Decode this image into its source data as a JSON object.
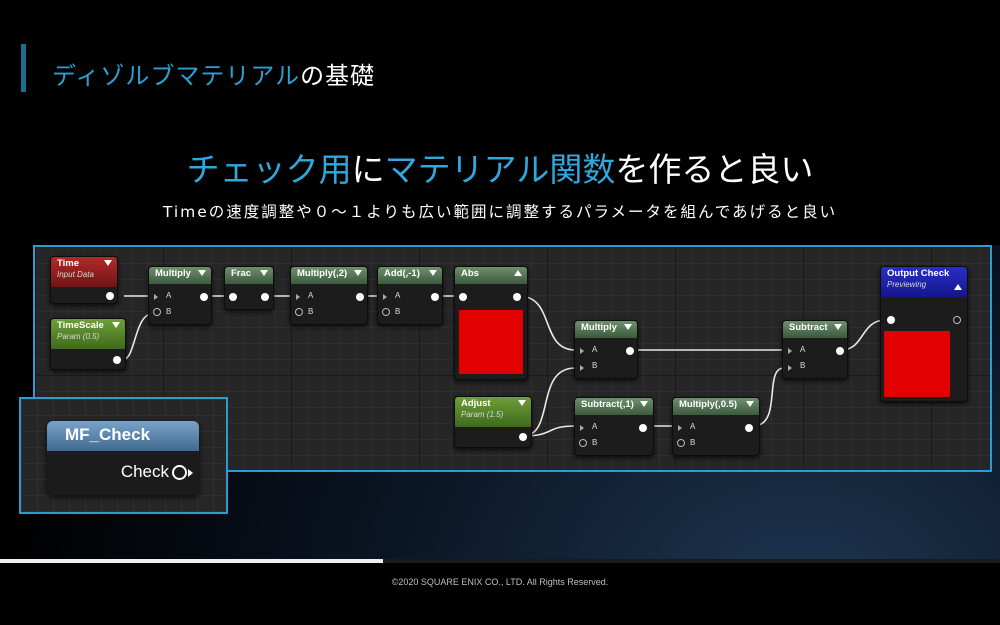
{
  "slide": {
    "title_blue": "ディゾルブマテリアル",
    "title_rest": "の基礎",
    "headline_1": "チェック用",
    "headline_2": "に",
    "headline_3": "マテリアル関数",
    "headline_4": "を作ると良い",
    "subtitle": "Timeの速度調整や０～１よりも広い範囲に調整するパラメータを組んであげると良い",
    "copyright": "©2020 SQUARE ENIX CO., LTD. All Rights Reserved.",
    "progress_fraction": 0.383
  },
  "graph": {
    "nodes": {
      "time": {
        "title": "Time",
        "subtitle": "Input Data"
      },
      "timescale": {
        "title": "TimeScale",
        "subtitle": "Param (0.5)"
      },
      "multiply1": {
        "title": "Multiply",
        "a": "A",
        "b": "B"
      },
      "frac": {
        "title": "Frac"
      },
      "multiply2": {
        "title": "Multiply(,2)",
        "a": "A",
        "b": "B"
      },
      "add": {
        "title": "Add(,-1)",
        "a": "A",
        "b": "B"
      },
      "abs": {
        "title": "Abs"
      },
      "multiply3": {
        "title": "Multiply",
        "a": "A",
        "b": "B"
      },
      "adjust": {
        "title": "Adjust",
        "subtitle": "Param (1.5)"
      },
      "subtract1": {
        "title": "Subtract(,1)",
        "a": "A",
        "b": "B"
      },
      "multiply4": {
        "title": "Multiply(,0.5)",
        "a": "A",
        "b": "B"
      },
      "subtract2": {
        "title": "Subtract",
        "a": "A",
        "b": "B"
      },
      "output": {
        "title": "Output Check",
        "subtitle": "Previewing"
      }
    },
    "colors": {
      "wire": "#e8e8e8",
      "preview": "#e30000",
      "frame": "#2b9bd0"
    }
  },
  "mf_check": {
    "title": "MF_Check",
    "output_label": "Check"
  }
}
